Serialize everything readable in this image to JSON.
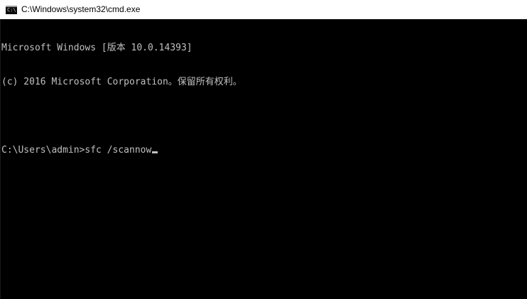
{
  "window": {
    "title": "C:\\Windows\\system32\\cmd.exe",
    "icon": "cmd-icon",
    "icon_glyph": "C:\\"
  },
  "console": {
    "lines": [
      "Microsoft Windows [版本 10.0.14393]",
      "(c) 2016 Microsoft Corporation。保留所有权利。",
      "",
      "C:\\Users\\admin>sfc /scannow"
    ],
    "text_color": "#c0c0c0",
    "background_color": "#000000"
  }
}
